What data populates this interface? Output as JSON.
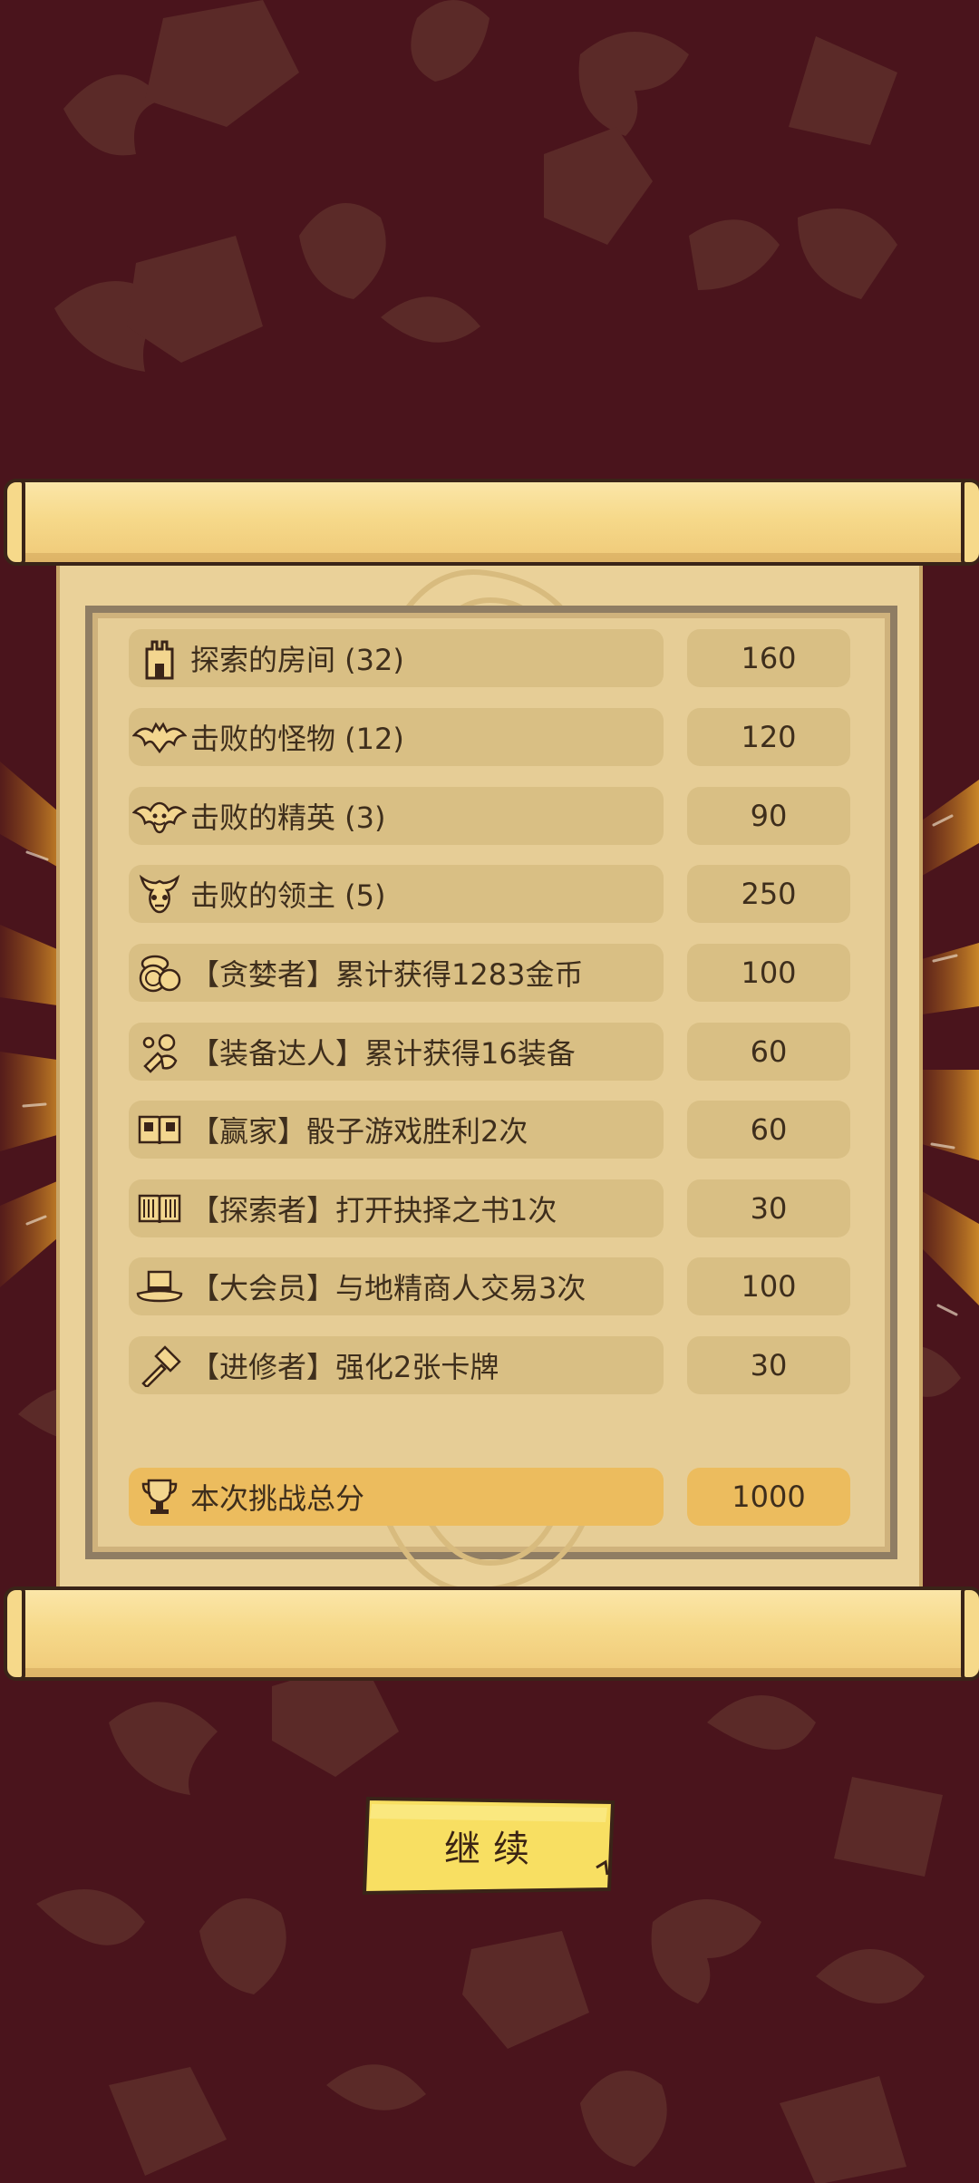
{
  "colors": {
    "background": "#4a141c",
    "pattern": "#5b2a28",
    "paper": "#ead199",
    "row_fill": "#d9bf84",
    "total_fill": "#ecbc5e",
    "button_fill": "#f8df62",
    "text": "#3e2e1c"
  },
  "score_rows": [
    {
      "icon": "tower-icon",
      "label": "探索的房间 (32)",
      "value": "160"
    },
    {
      "icon": "bat-icon",
      "label": "击败的怪物 (12)",
      "value": "120"
    },
    {
      "icon": "winged-demon-icon",
      "label": "击败的精英 (3)",
      "value": "90"
    },
    {
      "icon": "horned-skull-icon",
      "label": "击败的领主 (5)",
      "value": "250"
    },
    {
      "icon": "coins-icon",
      "label": "【贪婪者】累计获得1283金币",
      "value": "100"
    },
    {
      "icon": "gear-pile-icon",
      "label": "【装备达人】累计获得16装备",
      "value": "60"
    },
    {
      "icon": "dice-book-icon",
      "label": "【赢家】骰子游戏胜利2次",
      "value": "60"
    },
    {
      "icon": "open-book-icon",
      "label": "【探索者】打开抉择之书1次",
      "value": "30"
    },
    {
      "icon": "top-hat-icon",
      "label": "【大会员】与地精商人交易3次",
      "value": "100"
    },
    {
      "icon": "hammer-icon",
      "label": "【进修者】强化2张卡牌",
      "value": "30"
    }
  ],
  "total": {
    "icon": "trophy-icon",
    "label": "本次挑战总分",
    "value": "1000"
  },
  "continue_button": {
    "label": "继续"
  }
}
